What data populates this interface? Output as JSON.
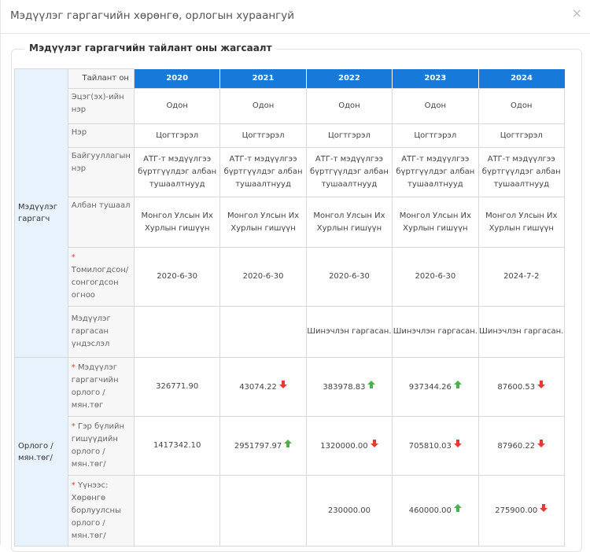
{
  "modal": {
    "title": "Мэдүүлэг гаргагчийн хөрөнгө, орлогын хураангуй",
    "close": "×"
  },
  "fieldset": {
    "legend": "Мэдүүлэг гаргагчийн тайлант оны жагсаалт"
  },
  "table": {
    "year_header": "Тайлант он",
    "years": [
      "2020",
      "2021",
      "2022",
      "2023",
      "2024"
    ],
    "sections": {
      "declarant": "Мэдүүлэг гаргагч",
      "income": "Орлого / мян.төг/"
    },
    "rows": {
      "patronymic": {
        "label": "Эцэг(эх)-ийн нэр",
        "values": [
          "Одон",
          "Одон",
          "Одон",
          "Одон",
          "Одон"
        ]
      },
      "name": {
        "label": "Нэр",
        "values": [
          "Цогтгэрэл",
          "Цогтгэрэл",
          "Цогтгэрэл",
          "Цогтгэрэл",
          "Цогтгэрэл"
        ]
      },
      "organization": {
        "label": "Байгууллагын нэр",
        "values": [
          "АТГ-т мэдүүлгээ бүртгүүлдэг албан тушаалтнууд",
          "АТГ-т мэдүүлгээ бүртгүүлдэг албан тушаалтнууд",
          "АТГ-т мэдүүлгээ бүртгүүлдэг албан тушаалтнууд",
          "АТГ-т мэдүүлгээ бүртгүүлдэг албан тушаалтнууд",
          "АТГ-т мэдүүлгээ бүртгүүлдэг албан тушаалтнууд"
        ]
      },
      "position": {
        "label": "Албан тушаал",
        "values": [
          "Монгол Улсын Их Хурлын гишүүн",
          "Монгол Улсын Их Хурлын гишүүн",
          "Монгол Улсын Их Хурлын гишүүн",
          "Монгол Улсын Их Хурлын гишүүн",
          "Монгол Улсын Их Хурлын гишүүн"
        ]
      },
      "appointed_date": {
        "required": "*",
        "label": "Томилогдсон/ сонгогдсон огноо",
        "values": [
          "2020-6-30",
          "2020-6-30",
          "2020-6-30",
          "2020-6-30",
          "2024-7-2"
        ]
      },
      "reason": {
        "label": "Мэдүүлэг гаргасан үндэслэл",
        "values": [
          "",
          "",
          "Шинэчлэн гаргасан.",
          "Шинэчлэн гаргасан.",
          "Шинэчлэн гаргасан."
        ]
      },
      "declarant_income": {
        "required": "*",
        "label": "Мэдүүлэг гаргагчийн орлого / мян.төг",
        "values": [
          "326771.90",
          "43074.22",
          "383978.83",
          "937344.26",
          "87600.53"
        ],
        "trend": [
          "none",
          "down",
          "up",
          "up",
          "down"
        ]
      },
      "family_income": {
        "required": "*",
        "label": "Гэр бүлийн гишүүдийн орлого / мян.төг/",
        "values": [
          "1417342.10",
          "2951797.97",
          "1320000.00",
          "705810.03",
          "87960.22"
        ],
        "trend": [
          "none",
          "up",
          "down",
          "down",
          "down"
        ]
      },
      "asset_sale_income": {
        "required": "*",
        "label": "Үүнээс: Хөрөнгө борлуулсны орлого / мян.төг/",
        "values": [
          "",
          "",
          "230000.00",
          "460000.00",
          "275900.00"
        ],
        "trend": [
          "none",
          "none",
          "none",
          "up",
          "down"
        ]
      }
    }
  },
  "colors": {
    "up": "#4caf50",
    "down": "#e53935",
    "header": "#1779d9",
    "section_bg": "#e8f2fc"
  },
  "icons": {
    "up": "up-arrow-icon",
    "down": "down-arrow-icon",
    "close": "close-icon"
  }
}
